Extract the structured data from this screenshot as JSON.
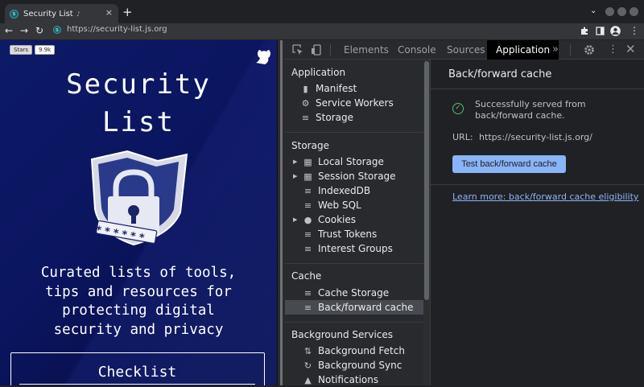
{
  "browser": {
    "tab_title": "Security List",
    "tab_close": "×",
    "new_tab": "+",
    "url": "https://security-list.js.org",
    "favicon_letter": "s"
  },
  "page": {
    "stars_label": "Stars",
    "stars_count": "9.9k",
    "title_line1": "Security",
    "title_line2": "List",
    "tagline": [
      "Curated lists of tools,",
      "tips and resources for",
      "protecting digital",
      "security and privacy"
    ],
    "checklist_title": "Checklist",
    "lock_password": "******"
  },
  "devtools": {
    "tabs": [
      "Elements",
      "Console",
      "Sources",
      "Application"
    ],
    "selected_tab": "Application",
    "overflow": "»",
    "sidebar": {
      "application_header": "Application",
      "application_items": [
        "Manifest",
        "Service Workers",
        "Storage"
      ],
      "storage_header": "Storage",
      "storage_items": [
        "Local Storage",
        "Session Storage",
        "IndexedDB",
        "Web SQL",
        "Cookies",
        "Trust Tokens",
        "Interest Groups"
      ],
      "cache_header": "Cache",
      "cache_items": [
        "Cache Storage",
        "Back/forward cache"
      ],
      "bg_header": "Background Services",
      "bg_items": [
        "Background Fetch",
        "Background Sync",
        "Notifications"
      ]
    },
    "main": {
      "title": "Back/forward cache",
      "success_message": "Successfully served from back/forward cache.",
      "url_label": "URL:",
      "url_value": "https://security-list.js.org/",
      "test_button": "Test back/forward cache",
      "learn_more": "Learn more: back/forward cache eligibility"
    }
  },
  "colors": {
    "accent": "#8ab4f8",
    "success": "#5bb974",
    "page_bg": "#0d1a66"
  }
}
